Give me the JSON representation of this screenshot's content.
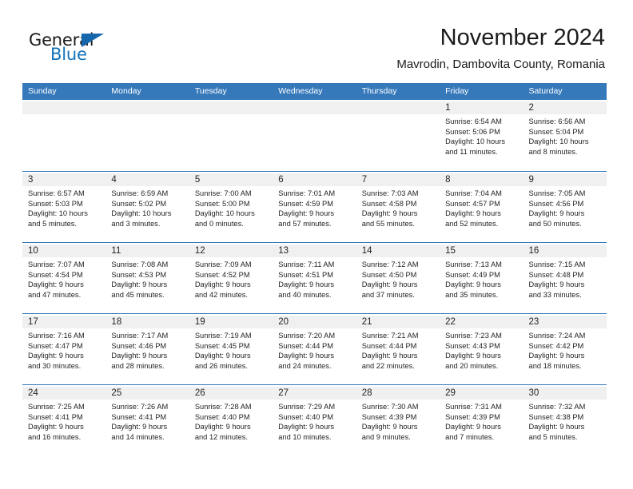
{
  "brand": {
    "name_part1": "General",
    "name_part2": "Blue",
    "triangle_color": "#1667ad",
    "blue_color": "#1373ba"
  },
  "header": {
    "title": "November 2024",
    "subtitle": "Mavrodin, Dambovita County, Romania"
  },
  "theme": {
    "header_band": "#3679bb",
    "day_number_bg": "#f0f0f0",
    "text": "#231f20"
  },
  "weekdays": [
    "Sunday",
    "Monday",
    "Tuesday",
    "Wednesday",
    "Thursday",
    "Friday",
    "Saturday"
  ],
  "weeks": [
    [
      {
        "day": "",
        "sunrise": "",
        "sunset": "",
        "daylight_line1": "",
        "daylight_line2": ""
      },
      {
        "day": "",
        "sunrise": "",
        "sunset": "",
        "daylight_line1": "",
        "daylight_line2": ""
      },
      {
        "day": "",
        "sunrise": "",
        "sunset": "",
        "daylight_line1": "",
        "daylight_line2": ""
      },
      {
        "day": "",
        "sunrise": "",
        "sunset": "",
        "daylight_line1": "",
        "daylight_line2": ""
      },
      {
        "day": "",
        "sunrise": "",
        "sunset": "",
        "daylight_line1": "",
        "daylight_line2": ""
      },
      {
        "day": "1",
        "sunrise": "Sunrise: 6:54 AM",
        "sunset": "Sunset: 5:06 PM",
        "daylight_line1": "Daylight: 10 hours",
        "daylight_line2": "and 11 minutes."
      },
      {
        "day": "2",
        "sunrise": "Sunrise: 6:56 AM",
        "sunset": "Sunset: 5:04 PM",
        "daylight_line1": "Daylight: 10 hours",
        "daylight_line2": "and 8 minutes."
      }
    ],
    [
      {
        "day": "3",
        "sunrise": "Sunrise: 6:57 AM",
        "sunset": "Sunset: 5:03 PM",
        "daylight_line1": "Daylight: 10 hours",
        "daylight_line2": "and 5 minutes."
      },
      {
        "day": "4",
        "sunrise": "Sunrise: 6:59 AM",
        "sunset": "Sunset: 5:02 PM",
        "daylight_line1": "Daylight: 10 hours",
        "daylight_line2": "and 3 minutes."
      },
      {
        "day": "5",
        "sunrise": "Sunrise: 7:00 AM",
        "sunset": "Sunset: 5:00 PM",
        "daylight_line1": "Daylight: 10 hours",
        "daylight_line2": "and 0 minutes."
      },
      {
        "day": "6",
        "sunrise": "Sunrise: 7:01 AM",
        "sunset": "Sunset: 4:59 PM",
        "daylight_line1": "Daylight: 9 hours",
        "daylight_line2": "and 57 minutes."
      },
      {
        "day": "7",
        "sunrise": "Sunrise: 7:03 AM",
        "sunset": "Sunset: 4:58 PM",
        "daylight_line1": "Daylight: 9 hours",
        "daylight_line2": "and 55 minutes."
      },
      {
        "day": "8",
        "sunrise": "Sunrise: 7:04 AM",
        "sunset": "Sunset: 4:57 PM",
        "daylight_line1": "Daylight: 9 hours",
        "daylight_line2": "and 52 minutes."
      },
      {
        "day": "9",
        "sunrise": "Sunrise: 7:05 AM",
        "sunset": "Sunset: 4:56 PM",
        "daylight_line1": "Daylight: 9 hours",
        "daylight_line2": "and 50 minutes."
      }
    ],
    [
      {
        "day": "10",
        "sunrise": "Sunrise: 7:07 AM",
        "sunset": "Sunset: 4:54 PM",
        "daylight_line1": "Daylight: 9 hours",
        "daylight_line2": "and 47 minutes."
      },
      {
        "day": "11",
        "sunrise": "Sunrise: 7:08 AM",
        "sunset": "Sunset: 4:53 PM",
        "daylight_line1": "Daylight: 9 hours",
        "daylight_line2": "and 45 minutes."
      },
      {
        "day": "12",
        "sunrise": "Sunrise: 7:09 AM",
        "sunset": "Sunset: 4:52 PM",
        "daylight_line1": "Daylight: 9 hours",
        "daylight_line2": "and 42 minutes."
      },
      {
        "day": "13",
        "sunrise": "Sunrise: 7:11 AM",
        "sunset": "Sunset: 4:51 PM",
        "daylight_line1": "Daylight: 9 hours",
        "daylight_line2": "and 40 minutes."
      },
      {
        "day": "14",
        "sunrise": "Sunrise: 7:12 AM",
        "sunset": "Sunset: 4:50 PM",
        "daylight_line1": "Daylight: 9 hours",
        "daylight_line2": "and 37 minutes."
      },
      {
        "day": "15",
        "sunrise": "Sunrise: 7:13 AM",
        "sunset": "Sunset: 4:49 PM",
        "daylight_line1": "Daylight: 9 hours",
        "daylight_line2": "and 35 minutes."
      },
      {
        "day": "16",
        "sunrise": "Sunrise: 7:15 AM",
        "sunset": "Sunset: 4:48 PM",
        "daylight_line1": "Daylight: 9 hours",
        "daylight_line2": "and 33 minutes."
      }
    ],
    [
      {
        "day": "17",
        "sunrise": "Sunrise: 7:16 AM",
        "sunset": "Sunset: 4:47 PM",
        "daylight_line1": "Daylight: 9 hours",
        "daylight_line2": "and 30 minutes."
      },
      {
        "day": "18",
        "sunrise": "Sunrise: 7:17 AM",
        "sunset": "Sunset: 4:46 PM",
        "daylight_line1": "Daylight: 9 hours",
        "daylight_line2": "and 28 minutes."
      },
      {
        "day": "19",
        "sunrise": "Sunrise: 7:19 AM",
        "sunset": "Sunset: 4:45 PM",
        "daylight_line1": "Daylight: 9 hours",
        "daylight_line2": "and 26 minutes."
      },
      {
        "day": "20",
        "sunrise": "Sunrise: 7:20 AM",
        "sunset": "Sunset: 4:44 PM",
        "daylight_line1": "Daylight: 9 hours",
        "daylight_line2": "and 24 minutes."
      },
      {
        "day": "21",
        "sunrise": "Sunrise: 7:21 AM",
        "sunset": "Sunset: 4:44 PM",
        "daylight_line1": "Daylight: 9 hours",
        "daylight_line2": "and 22 minutes."
      },
      {
        "day": "22",
        "sunrise": "Sunrise: 7:23 AM",
        "sunset": "Sunset: 4:43 PM",
        "daylight_line1": "Daylight: 9 hours",
        "daylight_line2": "and 20 minutes."
      },
      {
        "day": "23",
        "sunrise": "Sunrise: 7:24 AM",
        "sunset": "Sunset: 4:42 PM",
        "daylight_line1": "Daylight: 9 hours",
        "daylight_line2": "and 18 minutes."
      }
    ],
    [
      {
        "day": "24",
        "sunrise": "Sunrise: 7:25 AM",
        "sunset": "Sunset: 4:41 PM",
        "daylight_line1": "Daylight: 9 hours",
        "daylight_line2": "and 16 minutes."
      },
      {
        "day": "25",
        "sunrise": "Sunrise: 7:26 AM",
        "sunset": "Sunset: 4:41 PM",
        "daylight_line1": "Daylight: 9 hours",
        "daylight_line2": "and 14 minutes."
      },
      {
        "day": "26",
        "sunrise": "Sunrise: 7:28 AM",
        "sunset": "Sunset: 4:40 PM",
        "daylight_line1": "Daylight: 9 hours",
        "daylight_line2": "and 12 minutes."
      },
      {
        "day": "27",
        "sunrise": "Sunrise: 7:29 AM",
        "sunset": "Sunset: 4:40 PM",
        "daylight_line1": "Daylight: 9 hours",
        "daylight_line2": "and 10 minutes."
      },
      {
        "day": "28",
        "sunrise": "Sunrise: 7:30 AM",
        "sunset": "Sunset: 4:39 PM",
        "daylight_line1": "Daylight: 9 hours",
        "daylight_line2": "and 9 minutes."
      },
      {
        "day": "29",
        "sunrise": "Sunrise: 7:31 AM",
        "sunset": "Sunset: 4:39 PM",
        "daylight_line1": "Daylight: 9 hours",
        "daylight_line2": "and 7 minutes."
      },
      {
        "day": "30",
        "sunrise": "Sunrise: 7:32 AM",
        "sunset": "Sunset: 4:38 PM",
        "daylight_line1": "Daylight: 9 hours",
        "daylight_line2": "and 5 minutes."
      }
    ]
  ]
}
